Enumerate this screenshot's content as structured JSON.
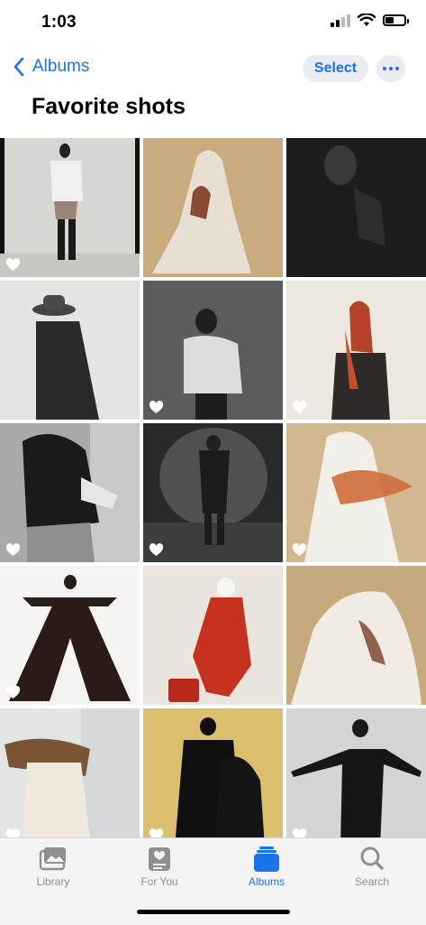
{
  "status": {
    "time": "1:03",
    "battery_level": 0.45
  },
  "nav": {
    "back_label": "Albums",
    "select_label": "Select",
    "more_icon": "ellipsis-icon"
  },
  "page": {
    "title": "Favorite shots"
  },
  "photos": [
    {
      "subject": "figure in white top and black boots against light wall",
      "favorite": true
    },
    {
      "subject": "figure in cream draped coat on tan background",
      "favorite": false
    },
    {
      "subject": "dark hooded figure on black background",
      "favorite": false
    },
    {
      "subject": "figure in wide-brim hat and long dark coat",
      "favorite": false
    },
    {
      "subject": "figure in white puffer jacket on grey background",
      "favorite": true
    },
    {
      "subject": "figure with rust scarf draped over head",
      "favorite": true
    },
    {
      "subject": "black and white figure with backpack straps",
      "favorite": true
    },
    {
      "subject": "figure in shadowed hallway",
      "favorite": true
    },
    {
      "subject": "white draped figure with orange fabric",
      "favorite": true
    },
    {
      "subject": "figure in wide black trousers arms outstretched",
      "favorite": true
    },
    {
      "subject": "figure in red outfit with red bag",
      "favorite": false
    },
    {
      "subject": "draped white fabric over figure",
      "favorite": false
    },
    {
      "subject": "figure with leopard fabric and cream dress",
      "favorite": true
    },
    {
      "subject": "silhouetted figures against yellow background",
      "favorite": true
    },
    {
      "subject": "figure in black suit arms outstretched",
      "favorite": true
    }
  ],
  "tabs": [
    {
      "label": "Library",
      "icon": "photo-library-icon",
      "active": false
    },
    {
      "label": "For You",
      "icon": "for-you-icon",
      "active": false
    },
    {
      "label": "Albums",
      "icon": "albums-icon",
      "active": true
    },
    {
      "label": "Search",
      "icon": "search-icon",
      "active": false
    }
  ],
  "colors": {
    "accent": "#1a73e8",
    "inactive": "#8e8e93"
  }
}
